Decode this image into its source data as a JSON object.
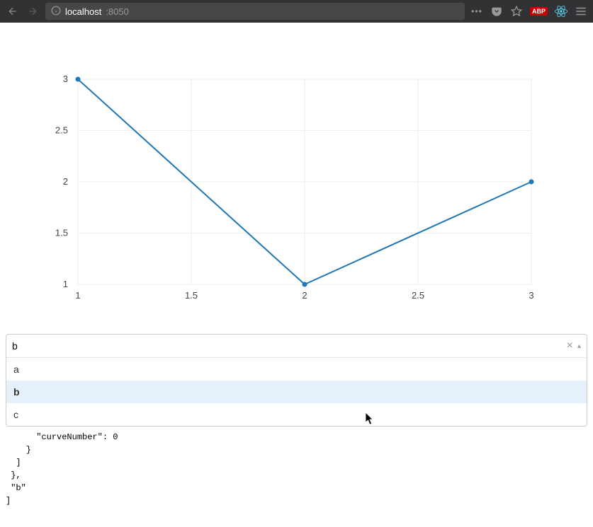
{
  "browser": {
    "url_host": "localhost",
    "url_port": ":8050",
    "abp_label": "ABP"
  },
  "chart_data": {
    "type": "line",
    "x": [
      1,
      2,
      3
    ],
    "y": [
      3,
      1,
      2
    ],
    "xlim": [
      1,
      3
    ],
    "ylim": [
      1,
      3
    ],
    "xticks": [
      1,
      1.5,
      2,
      2.5,
      3
    ],
    "yticks": [
      1,
      1.5,
      2,
      2.5,
      3
    ],
    "line_color": "#1f77b4"
  },
  "dropdown": {
    "input_value": "b",
    "options": [
      {
        "label": "a",
        "highlighted": false
      },
      {
        "label": "b",
        "highlighted": true
      },
      {
        "label": "c",
        "highlighted": false
      }
    ],
    "clear_symbol": "×",
    "arrow_symbol": "▴"
  },
  "code": {
    "line1": "      \"curveNumber\": 0",
    "line2": "    }",
    "line3": "  ]",
    "line4": " },",
    "line5": " \"b\"",
    "line6": "]"
  }
}
